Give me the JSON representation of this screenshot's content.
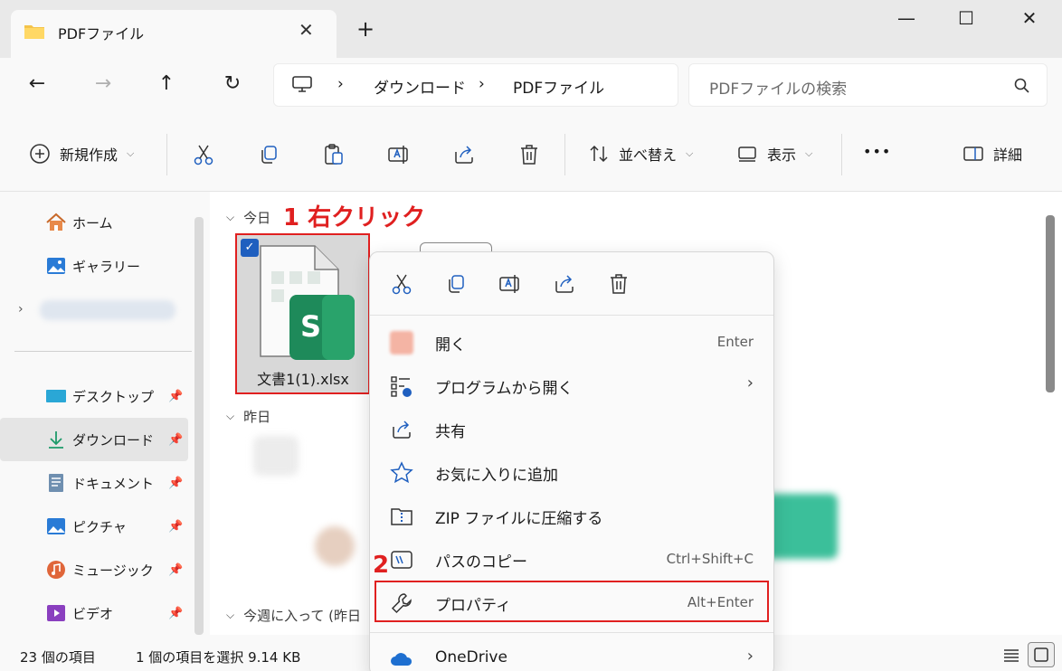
{
  "window": {
    "tab_title": "PDFファイル",
    "new_tab": "+",
    "minimize": "—",
    "maximize": "☐",
    "close": "✕"
  },
  "nav": {
    "back": "←",
    "forward": "→",
    "up": "↑",
    "refresh": "↻",
    "breadcrumb": [
      "ダウンロード",
      "PDFファイル"
    ],
    "separator": "›",
    "search_placeholder": "PDFファイルの検索"
  },
  "toolbar": {
    "new_label": "新規作成",
    "sort_label": "並べ替え",
    "view_label": "表示",
    "more": "•••",
    "details_label": "詳細"
  },
  "sidebar": {
    "items": [
      {
        "label": "ホーム",
        "icon": "home-icon"
      },
      {
        "label": "ギャラリー",
        "icon": "gallery-icon"
      },
      {
        "label": "",
        "icon": "cloud-icon"
      },
      {
        "label": "デスクトップ",
        "icon": "desktop-icon"
      },
      {
        "label": "ダウンロード",
        "icon": "download-icon"
      },
      {
        "label": "ドキュメント",
        "icon": "documents-icon"
      },
      {
        "label": "ピクチャ",
        "icon": "pictures-icon"
      },
      {
        "label": "ミュージック",
        "icon": "music-icon"
      },
      {
        "label": "ビデオ",
        "icon": "video-icon"
      }
    ]
  },
  "content": {
    "groups": [
      "今日",
      "昨日",
      "今週に入って (昨日"
    ],
    "selected_file": "文書1(1).xlsx",
    "file_badge": "S"
  },
  "annotations": {
    "step1": "1 右クリック",
    "step2": "2"
  },
  "context_menu": {
    "items": [
      {
        "label": "開く",
        "shortcut": "Enter"
      },
      {
        "label": "プログラムから開く",
        "shortcut": "›"
      },
      {
        "label": "共有",
        "shortcut": ""
      },
      {
        "label": "お気に入りに追加",
        "shortcut": ""
      },
      {
        "label": "ZIP ファイルに圧縮する",
        "shortcut": ""
      },
      {
        "label": "パスのコピー",
        "shortcut": "Ctrl+Shift+C"
      },
      {
        "label": "プロパティ",
        "shortcut": "Alt+Enter"
      },
      {
        "label": "OneDrive",
        "shortcut": "›"
      }
    ]
  },
  "status": {
    "count": "23 個の項目",
    "selection": "1 個の項目を選択  9.14 KB"
  },
  "colors": {
    "annotation": "#e02020",
    "accent": "#1f5fbf",
    "excel_green": "#1e8a5a"
  }
}
